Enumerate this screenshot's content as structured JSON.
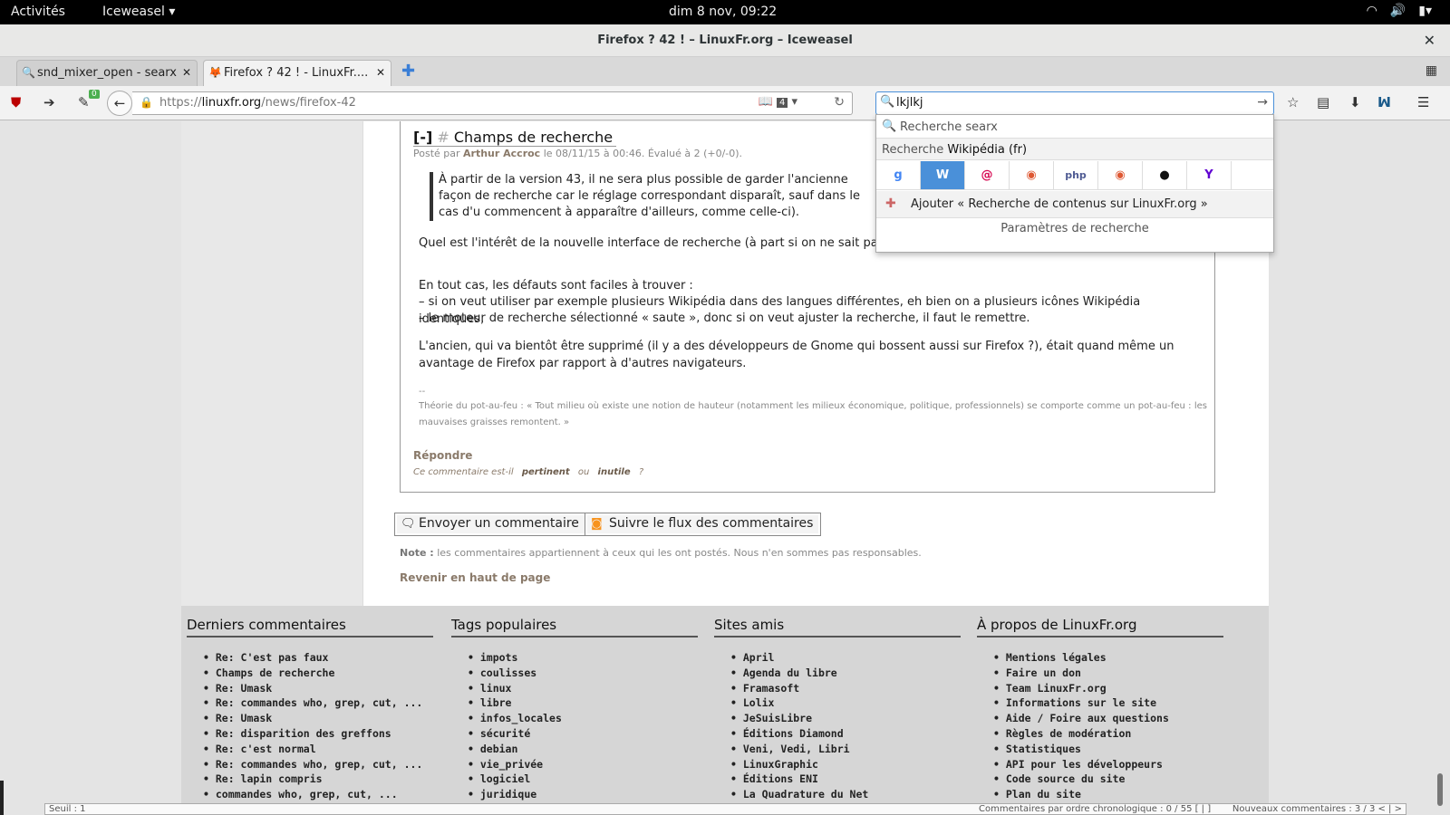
{
  "topbar": {
    "activities": "Activités",
    "app_menu": "Iceweasel ▾",
    "clock": "dim  8 nov, 09:22",
    "tray": [
      "wifi-icon",
      "volume-icon",
      "battery-icon"
    ]
  },
  "window": {
    "title": "Firefox ? 42 ! – LinuxFr.org – Iceweasel",
    "close": "✕"
  },
  "tabs": [
    {
      "label": "snd_mixer_open - searx",
      "icon": "🔍",
      "close": "✕"
    },
    {
      "label": "Firefox ? 42 ! - LinuxFr....",
      "icon": "🦊",
      "close": "✕"
    }
  ],
  "newtab": "✚",
  "tabgrid": "▦",
  "navbar": {
    "badge": "0",
    "url_scheme": "https://",
    "url_host": "linuxfr.org",
    "url_path": "/news/firefox-42",
    "reader_count": "4",
    "search_value": "lkjlkj"
  },
  "comment": {
    "fold": "[-]",
    "hash": "#",
    "title": "Champs de recherche",
    "meta_prefix": "Posté par ",
    "author": "Arthur Accroc",
    "meta_suffix": " le 08/11/15 à 00:46. Évalué à 2 (+0/-0).",
    "quote": "À partir de la version 43, il ne sera plus possible de garder l'ancienne façon de recherche car le réglage correspondant disparaît, sauf dans le cas d'u commencent à apparaître d'ailleurs, comme celle-ci).",
    "p1": "Quel est l'intérêt de la nouvelle interface de recherche (à part si on ne sait pas                                                                           une recherche) ?",
    "p2a": "En tout cas, les défauts sont faciles à trouver :",
    "p2b": "– si on veut utiliser par exemple plusieurs Wikipédia dans des langues différentes, eh bien on a plusieurs icônes Wikipédia identiques,",
    "p2c": "– le moteur de recherche sélectionné « saute », donc si on veut ajuster la recherche, il faut le remettre.",
    "p3": "L'ancien, qui va bientôt être supprimé (il y a des développeurs de Gnome qui bossent aussi sur Firefox ?), était quand même un avantage de Firefox par rapport à d'autres navigateurs.",
    "sig_sep": "--",
    "sig": "Théorie du pot-au-feu : « Tout milieu où existe une notion de hauteur (notamment les milieux économique, politique, professionnels) se comporte comme un pot-au-feu : les mauvaises graisses remontent. »",
    "reply": "Répondre",
    "vote_prefix": "Ce commentaire est-il",
    "vote_yes": "pertinent",
    "vote_or": "ou",
    "vote_no": "inutile",
    "vote_q": "?"
  },
  "buttons": {
    "send": "Envoyer un commentaire",
    "follow": "Suivre le flux des commentaires"
  },
  "note_label": "Note :",
  "note_text": " les commentaires appartiennent à ceux qui les ont postés. Nous n'en sommes pas responsables.",
  "backtop": "Revenir en haut de page",
  "footer": {
    "cols": [
      {
        "title": "Derniers commentaires",
        "items": [
          "Re: C'est pas faux",
          "Champs de recherche",
          "Re: Umask",
          "Re: commandes who, grep, cut, ...",
          "Re: Umask",
          "Re: disparition des greffons",
          "Re: c'est normal",
          "Re: commandes who, grep, cut, ...",
          "Re: lapin compris",
          "commandes who, grep, cut, ..."
        ]
      },
      {
        "title": "Tags populaires",
        "items": [
          "impots",
          "coulisses",
          "linux",
          "libre",
          "infos_locales",
          "sécurité",
          "debian",
          "vie_privée",
          "logiciel",
          "juridique"
        ]
      },
      {
        "title": "Sites amis",
        "items": [
          "April",
          "Agenda du libre",
          "Framasoft",
          "Lolix",
          "JeSuisLibre",
          "Éditions Diamond",
          "Veni, Vedi, Libri",
          "LinuxGraphic",
          "Éditions ENI",
          "La Quadrature du Net"
        ]
      },
      {
        "title": "À propos de LinuxFr.org",
        "items": [
          "Mentions légales",
          "Faire un don",
          "Team LinuxFr.org",
          "Informations sur le site",
          "Aide / Foire aux questions",
          "Règles de modération",
          "Statistiques",
          "API pour les développeurs",
          "Code source du site",
          "Plan du site"
        ]
      }
    ]
  },
  "dropdown": {
    "searx": "Recherche searx",
    "current_prefix": "Recherche ",
    "current_engine": "Wikipédia (fr)",
    "engines": [
      {
        "name": "google-icon",
        "glyph": "g"
      },
      {
        "name": "wikipedia-icon",
        "glyph": "W"
      },
      {
        "name": "debian-icon",
        "glyph": "@"
      },
      {
        "name": "duckduckgo-icon",
        "glyph": "◉"
      },
      {
        "name": "php-icon",
        "glyph": "php"
      },
      {
        "name": "duckduckgo-alt-icon",
        "glyph": "◉"
      },
      {
        "name": "github-icon",
        "glyph": "●"
      },
      {
        "name": "yahoo-icon",
        "glyph": "Y"
      }
    ],
    "add": "Ajouter « Recherche de contenus sur LinuxFr.org »",
    "params": "Paramètres de recherche"
  },
  "statusbar": {
    "left": "Seuil : 1",
    "middle": "Commentaires par ordre chronologique : 0 / 55 [ | ]",
    "right": "Nouveaux commentaires : 3 / 3 < | >"
  }
}
